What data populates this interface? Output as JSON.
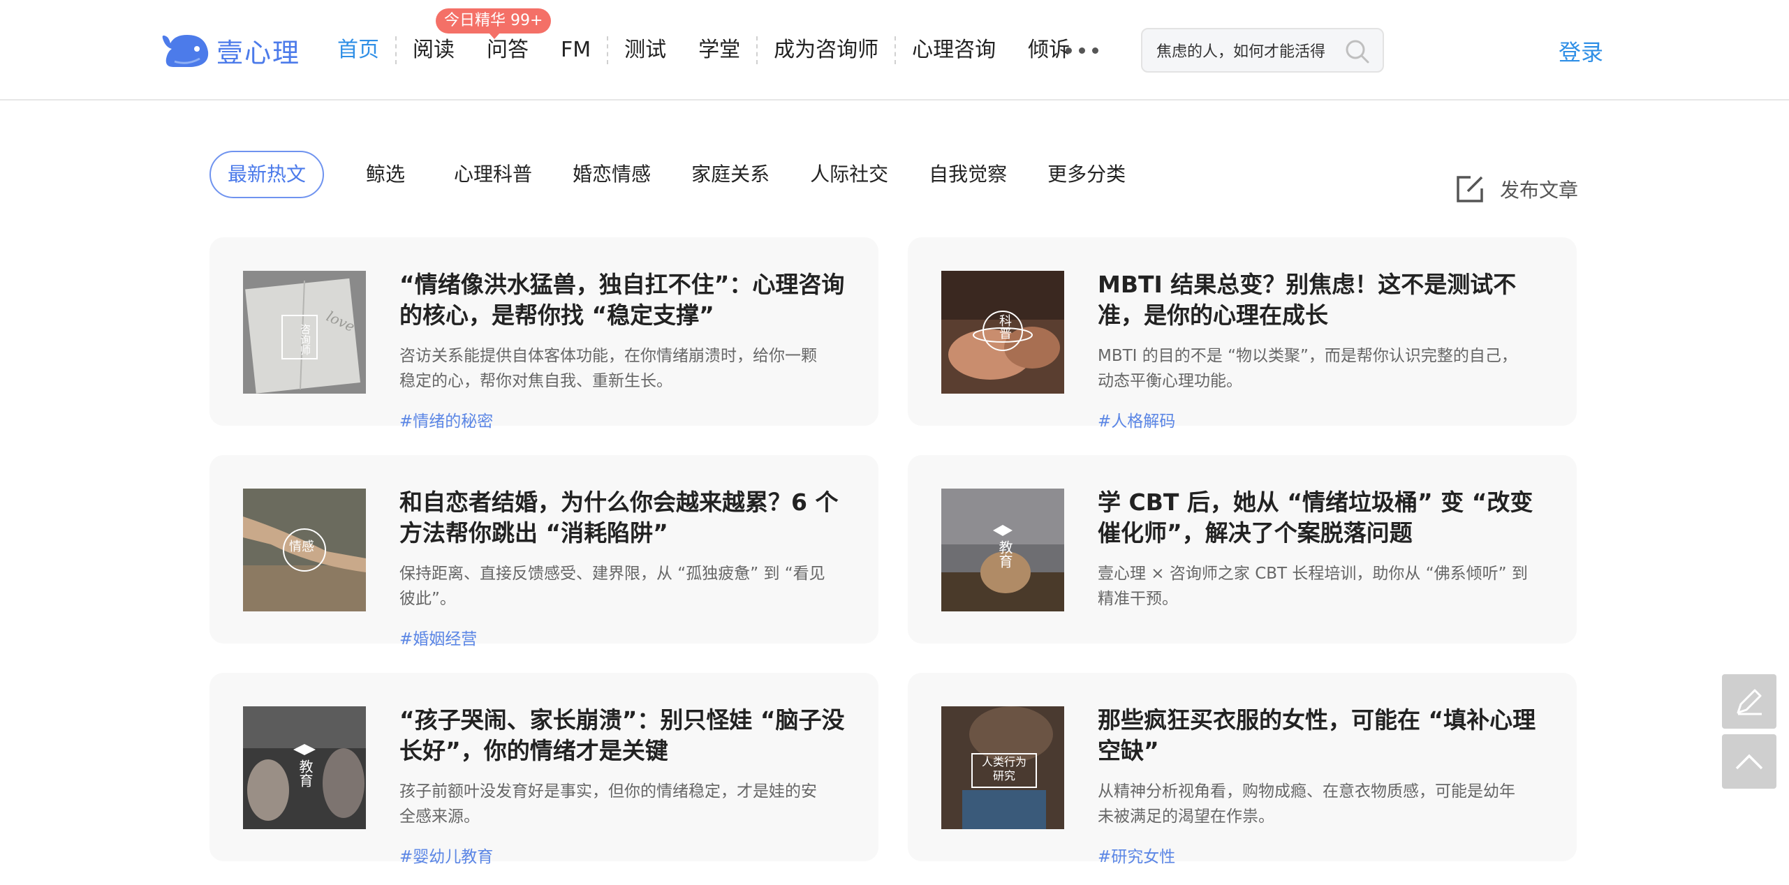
{
  "header": {
    "logo_text": "壹心理",
    "nav": [
      {
        "label": "首页",
        "active": true
      },
      {
        "label": "阅读"
      },
      {
        "label": "问答",
        "badge": "今日精华 99+"
      },
      {
        "label": "FM"
      },
      {
        "label": "测试"
      },
      {
        "label": "学堂"
      },
      {
        "label": "成为咨询师"
      },
      {
        "label": "心理咨询"
      },
      {
        "label": "倾诉"
      }
    ],
    "more_icon": "ellipsis-icon",
    "search": {
      "value": "焦虑的人，如何才能活得",
      "icon": "search-icon"
    },
    "login_label": "登录"
  },
  "tabs": [
    "最新热文",
    "鲸选",
    "心理科普",
    "婚恋情感",
    "家庭关系",
    "人际社交",
    "自我觉察",
    "更多分类"
  ],
  "publish_label": "发布文章",
  "articles": [
    {
      "title": "“情绪像洪水猛兽，独自扛不住”：心理咨询的核心，是帮你找 “稳定支撑”",
      "desc": "咨访关系能提供自体客体功能，在你情绪崩溃时，给你一颗稳定的心，帮你对焦自我、重新生长。",
      "tag": "#情绪的秘密",
      "thumb_text": "咨询师"
    },
    {
      "title": "MBTI 结果总变？别焦虑！这不是测试不准，是你的心理在成长",
      "desc": "MBTI 的目的不是 “物以类聚”，而是帮你认识完整的自己，动态平衡心理功能。",
      "tag": "#人格解码",
      "thumb_text": "科普"
    },
    {
      "title": "和自恋者结婚，为什么你会越来越累？6 个方法帮你跳出 “消耗陷阱”",
      "desc": "保持距离、直接反馈感受、建界限，从 “孤独疲惫” 到 “看见彼此”。",
      "tag": "#婚姻经营",
      "thumb_text": "情感"
    },
    {
      "title": "学 CBT 后，她从 “情绪垃圾桶” 变 “改变催化师”，解决了个案脱落问题",
      "desc": "壹心理 × 咨询师之家 CBT 长程培训，助你从 “佛系倾听” 到精准干预。",
      "tag": "",
      "thumb_text": "教育"
    },
    {
      "title": "“孩子哭闹、家长崩溃”：别只怪娃 “脑子没长好”，你的情绪才是关键",
      "desc": "孩子前额叶没发育好是事实，但你的情绪稳定，才是娃的安全感来源。",
      "tag": "#婴幼儿教育",
      "thumb_text": "教育"
    },
    {
      "title": "那些疯狂买衣服的女性，可能在 “填补心理空缺”",
      "desc": "从精神分析视角看，购物成瘾、在意衣物质感，可能是幼年未被满足的渴望在作祟。",
      "tag": "#研究女性",
      "thumb_text": "人类行为研究"
    }
  ],
  "colors": {
    "accent": "#2f8fe6",
    "brand": "#4c7bea",
    "badge": "#f47067",
    "tag": "#5b86e5"
  }
}
